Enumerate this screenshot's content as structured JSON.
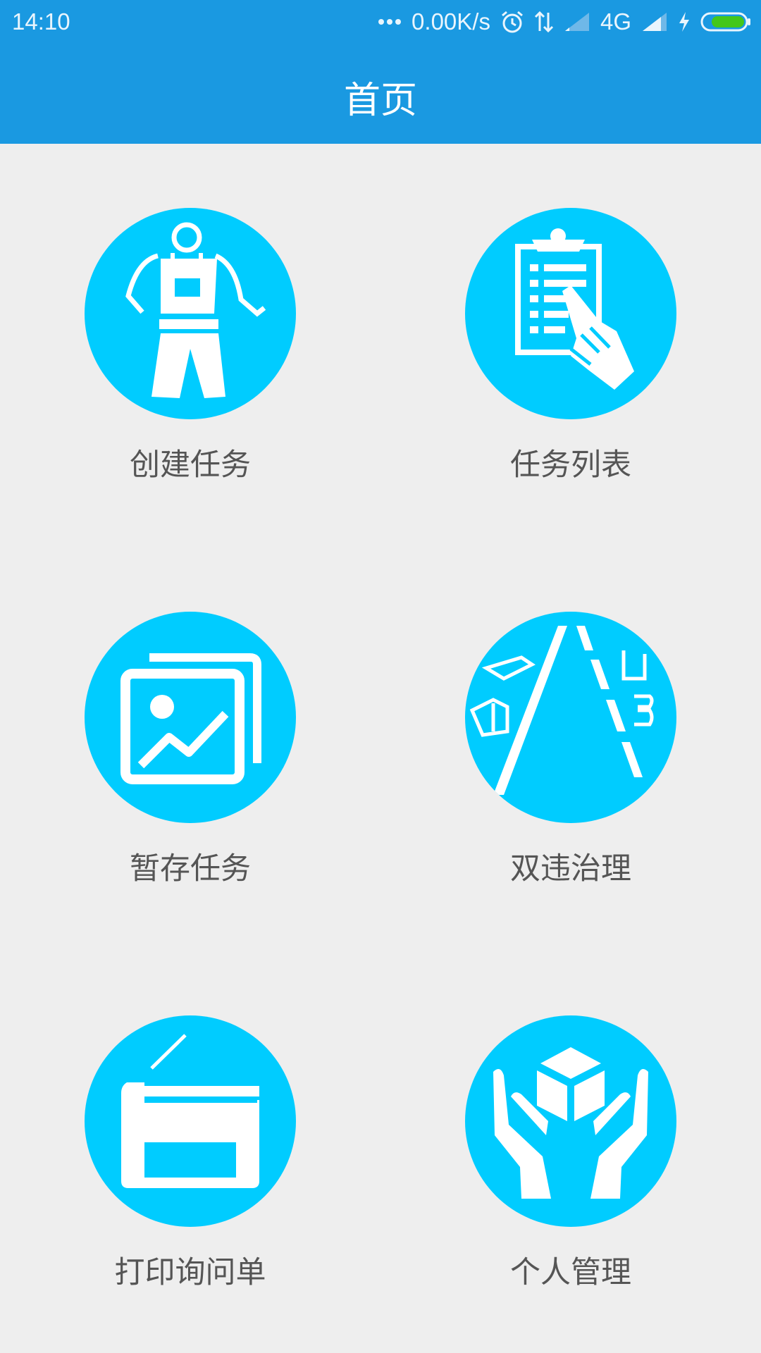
{
  "status_bar": {
    "time": "14:10",
    "network_speed": "0.00K/s",
    "network_type": "4G",
    "icons": [
      "more-dots-icon",
      "alarm-icon",
      "data-transfer-icon",
      "signal-weak-icon",
      "signal-icon",
      "charging-icon",
      "battery-icon"
    ],
    "battery_color": "#43C71A"
  },
  "header": {
    "title": "首页",
    "background": "#1A99E1"
  },
  "accent_color": "#00CCFF",
  "menu": [
    {
      "label": "创建任务",
      "icon": "worker-icon"
    },
    {
      "label": "任务列表",
      "icon": "clipboard-checklist-icon"
    },
    {
      "label": "暂存任务",
      "icon": "photo-gallery-icon"
    },
    {
      "label": "双违治理",
      "icon": "road-icon"
    },
    {
      "label": "打印询问单",
      "icon": "printer-icon"
    },
    {
      "label": "个人管理",
      "icon": "hands-box-icon"
    }
  ]
}
